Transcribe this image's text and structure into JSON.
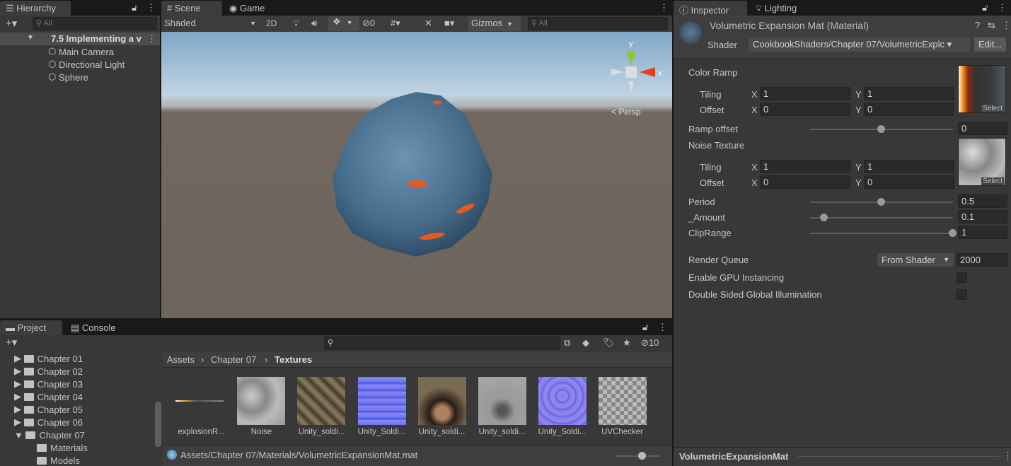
{
  "hierarchy": {
    "tab": "Hierarchy",
    "search_placeholder": "All",
    "scene": "7.5 Implementing a v",
    "items": [
      "Main Camera",
      "Directional Light",
      "Sphere"
    ]
  },
  "scene": {
    "tabs": [
      "Scene",
      "Game"
    ],
    "shading": "Shaded",
    "btn_2d": "2D",
    "hidden_count": "0",
    "gizmos": "Gizmos",
    "search_placeholder": "All",
    "persp": "< Persp",
    "axis_y": "y",
    "axis_x": "x"
  },
  "inspector": {
    "tabs": [
      "Inspector",
      "Lighting"
    ],
    "title": "Volumetric Expansion Mat (Material)",
    "shader_label": "Shader",
    "shader": "CookbookShaders/Chapter 07/VolumetricExplc",
    "edit": "Edit...",
    "color_ramp": "Color Ramp",
    "tiling": "Tiling",
    "offset": "Offset",
    "x": "X",
    "y": "Y",
    "select": "Select",
    "ramp_tiling": [
      "1",
      "1"
    ],
    "ramp_offset_xy": [
      "0",
      "0"
    ],
    "ramp_offset": {
      "label": "Ramp offset",
      "value": "0",
      "fraction": 0.5
    },
    "noise_texture": "Noise Texture",
    "noise_tiling": [
      "1",
      "1"
    ],
    "noise_offset": [
      "0",
      "0"
    ],
    "period": {
      "label": "Period",
      "value": "0.5",
      "fraction": 0.5
    },
    "amount": {
      "label": "_Amount",
      "value": "0.1",
      "fraction": 0.1
    },
    "cliprange": {
      "label": "ClipRange",
      "value": "1",
      "fraction": 1
    },
    "render_queue": {
      "label": "Render Queue",
      "mode": "From Shader",
      "value": "2000"
    },
    "gpu_instancing": "Enable GPU Instancing",
    "double_sided": "Double Sided Global Illumination",
    "footer": "VolumetricExpansionMat"
  },
  "project": {
    "tabs": [
      "Project",
      "Console"
    ],
    "hidden_count": "10",
    "folders": [
      "Chapter 01",
      "Chapter 02",
      "Chapter 03",
      "Chapter 04",
      "Chapter 05",
      "Chapter 06",
      "Chapter 07",
      "Materials",
      "Models"
    ],
    "breadcrumb": [
      "Assets",
      "Chapter 07",
      "Textures"
    ],
    "assets": [
      "explosionR...",
      "Noise",
      "Unity_soldi...",
      "Unity_Soldi...",
      "Unity_soldi...",
      "Unity_soldi...",
      "Unity_Soldi...",
      "UVChecker"
    ],
    "path": "Assets/Chapter 07/Materials/VolumetricExpansionMat.mat"
  }
}
